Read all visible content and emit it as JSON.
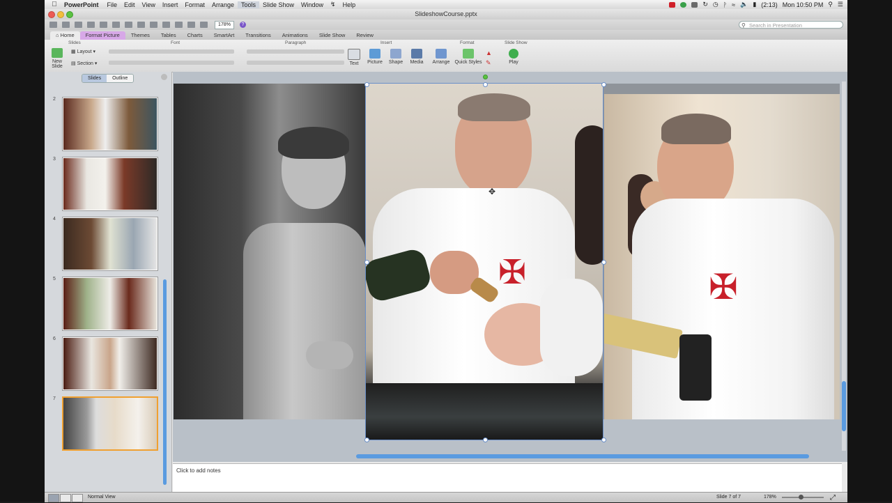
{
  "menubar": {
    "app_name": "PowerPoint",
    "items": [
      "File",
      "Edit",
      "View",
      "Insert",
      "Format",
      "Arrange",
      "Tools",
      "Slide Show",
      "Window",
      "Help"
    ],
    "active_item": "Tools",
    "battery": "(2:13)",
    "clock": "Mon 10:50 PM"
  },
  "window": {
    "title": "SlideshowCourse.pptx",
    "zoom": "178%",
    "search_placeholder": "Search in Presentation"
  },
  "ribbon": {
    "tabs": [
      "Home",
      "Format Picture",
      "Themes",
      "Tables",
      "Charts",
      "SmartArt",
      "Transitions",
      "Animations",
      "Slide Show",
      "Review"
    ],
    "group_titles": {
      "slides": "Slides",
      "font": "Font",
      "paragraph": "Paragraph",
      "insert": "Insert",
      "format": "Format",
      "slideshow": "Slide Show"
    },
    "buttons": {
      "new_slide": "New Slide",
      "layout": "Layout",
      "section": "Section",
      "text": "Text",
      "picture": "Picture",
      "shape": "Shape",
      "media": "Media",
      "arrange": "Arrange",
      "quick_styles": "Quick Styles",
      "play": "Play"
    }
  },
  "slides_pane": {
    "toggle_slides": "Slides",
    "toggle_outline": "Outline",
    "thumbnails": [
      "2",
      "3",
      "4",
      "5",
      "6",
      "7"
    ],
    "selected": "7"
  },
  "notes": {
    "placeholder": "Click to add notes"
  },
  "status": {
    "view": "Normal View",
    "slide_count": "Slide 7 of 7",
    "zoom": "178%"
  },
  "colors": {
    "selection_orange": "#f0a030",
    "scroll_blue": "#5a9be0",
    "format_tab": "#d7a8e7",
    "cross_red": "#c8202a"
  }
}
